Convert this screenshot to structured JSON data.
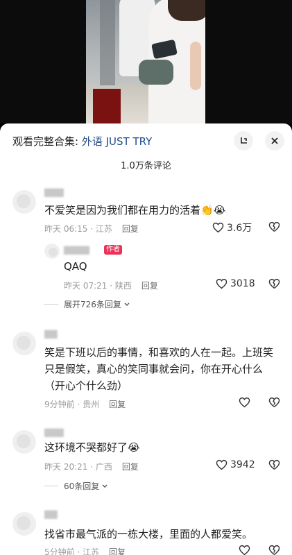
{
  "header": {
    "collection_prefix": "观看完整合集:",
    "collection_name": "外语 JUST TRY",
    "comment_count": "1.0万条评论"
  },
  "comments": [
    {
      "text": "不爱笑是因为我们都在用力的活着",
      "emoji": "👏😭",
      "time": "昨天 06:15 · 江苏",
      "reply": "回复",
      "likes": "3.6万",
      "replies": [
        {
          "badge": "作者",
          "text": "QAQ",
          "time": "昨天 07:21 · 陕西",
          "reply": "回复",
          "likes": "3018"
        }
      ],
      "expand": "展开726条回复"
    },
    {
      "text": "笑是下班以后的事情，和喜欢的人在一起。上班笑只是假笑，真心的笑同事就会问，你在开心什么（开心个什么劲）",
      "time": "9分钟前 · 贵州",
      "reply": "回复",
      "likes": ""
    },
    {
      "text": "这环境不哭都好了",
      "emoji": "😭",
      "time": "昨天 20:21 · 广西",
      "reply": "回复",
      "likes": "3942",
      "expand": "60条回复"
    },
    {
      "text": "找省市最气派的一栋大楼，里面的人都爱笑。",
      "time": "5分钟前 · 江苏",
      "reply": "回复",
      "likes": ""
    }
  ],
  "icons": {
    "minimize": "minimize-icon",
    "close": "close-icon",
    "like": "heart-icon",
    "dislike": "broken-heart-icon",
    "chevron": "chevron-down-icon"
  }
}
